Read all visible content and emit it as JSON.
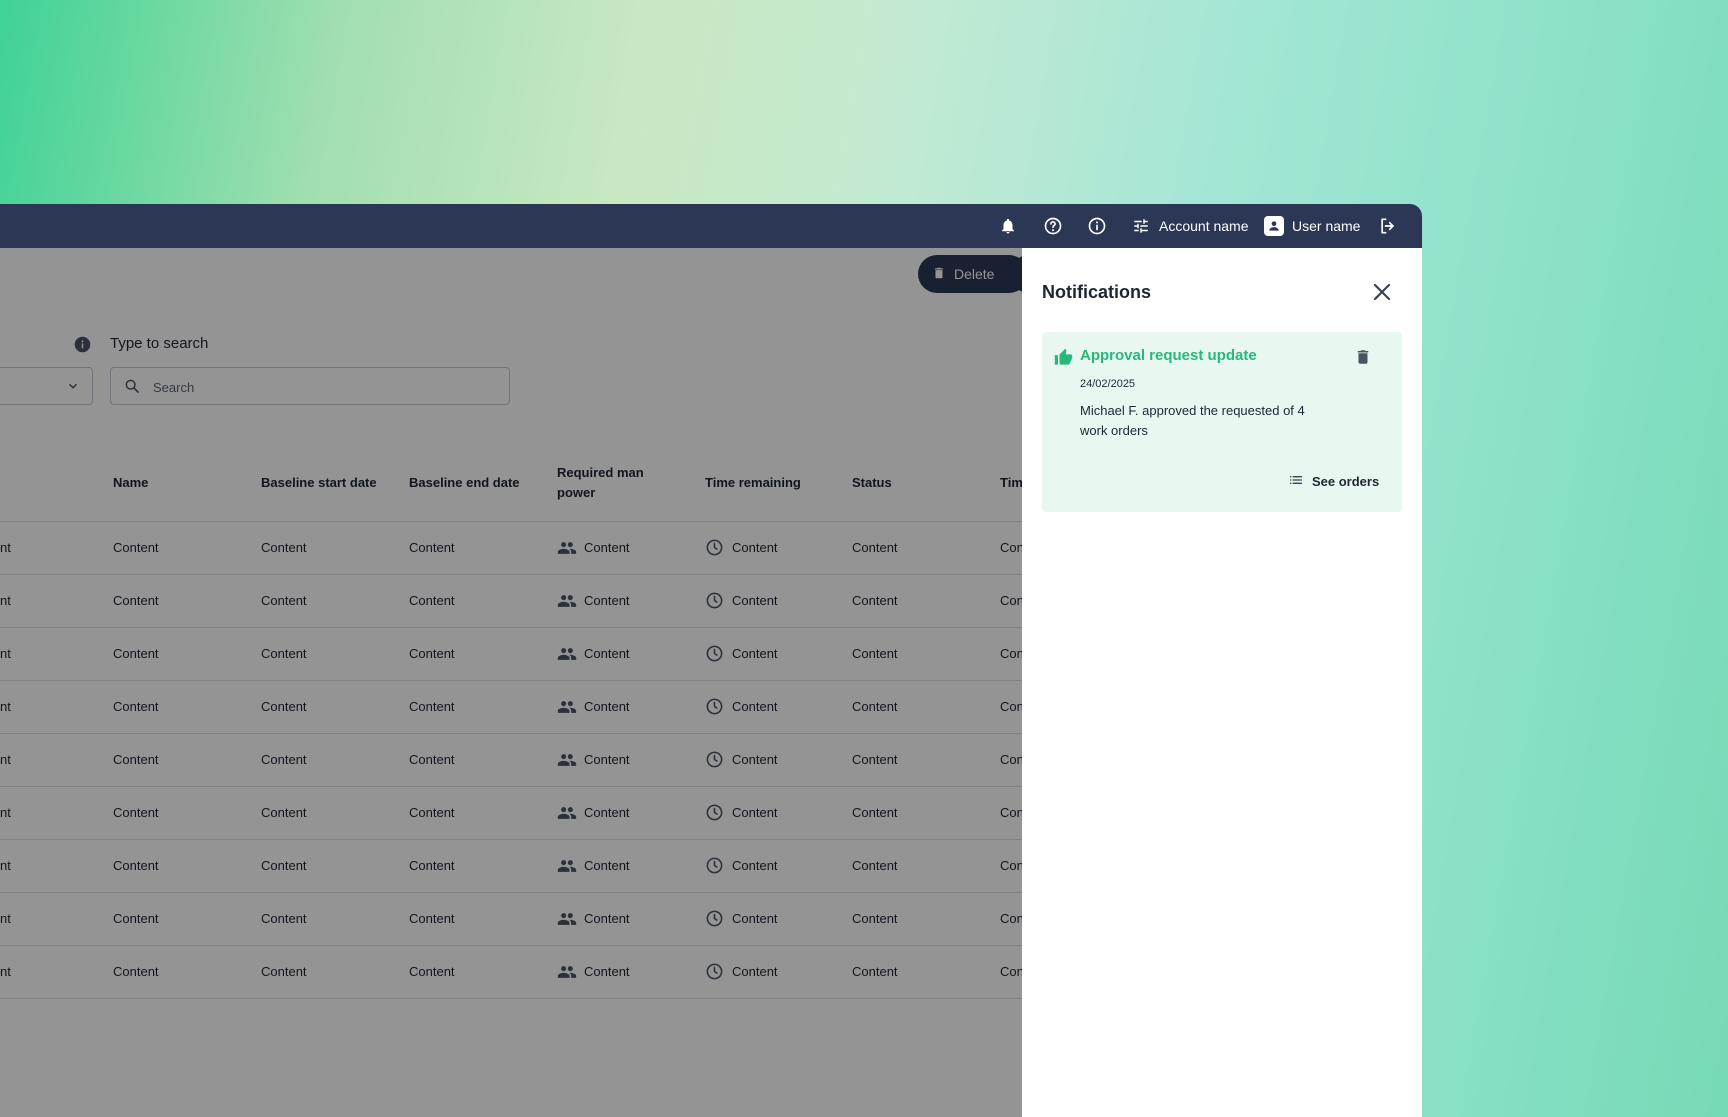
{
  "topbar": {
    "account_label": "Account name",
    "user_label": "User name",
    "icons": [
      "bell-icon",
      "help-icon",
      "info-icon",
      "sliders-icon",
      "user-icon",
      "logout-icon"
    ]
  },
  "toolbar": {
    "delete_label": "Delete"
  },
  "search": {
    "label": "Type to search",
    "placeholder": "Search"
  },
  "table": {
    "columns": [
      {
        "label": "Name"
      },
      {
        "label": "Baseline start date"
      },
      {
        "label": "Baseline end date"
      },
      {
        "label": "Required man power",
        "line1": "Required man",
        "line2": "power"
      },
      {
        "label": "Time remaining"
      },
      {
        "label": "Status"
      },
      {
        "label": "Tim"
      }
    ],
    "leading_fragment": "nt",
    "trailing_fragment": "Con",
    "rows": [
      [
        "Content",
        "Content",
        "Content",
        "Content",
        "Content",
        "Content"
      ],
      [
        "Content",
        "Content",
        "Content",
        "Content",
        "Content",
        "Content"
      ],
      [
        "Content",
        "Content",
        "Content",
        "Content",
        "Content",
        "Content"
      ],
      [
        "Content",
        "Content",
        "Content",
        "Content",
        "Content",
        "Content"
      ],
      [
        "Content",
        "Content",
        "Content",
        "Content",
        "Content",
        "Content"
      ],
      [
        "Content",
        "Content",
        "Content",
        "Content",
        "Content",
        "Content"
      ],
      [
        "Content",
        "Content",
        "Content",
        "Content",
        "Content",
        "Content"
      ],
      [
        "Content",
        "Content",
        "Content",
        "Content",
        "Content",
        "Content"
      ],
      [
        "Content",
        "Content",
        "Content",
        "Content",
        "Content",
        "Content"
      ]
    ]
  },
  "notifications": {
    "title": "Notifications",
    "items": [
      {
        "title": "Approval request update",
        "date": "24/02/2025",
        "message": "Michael F. approved the requested of 4 work orders",
        "action_label": "See orders",
        "icon": "thumbs-up-icon"
      }
    ]
  },
  "colors": {
    "navy": "#2c3756",
    "accent_green": "#27b97a",
    "notification_bg": "#e8f8f1"
  }
}
